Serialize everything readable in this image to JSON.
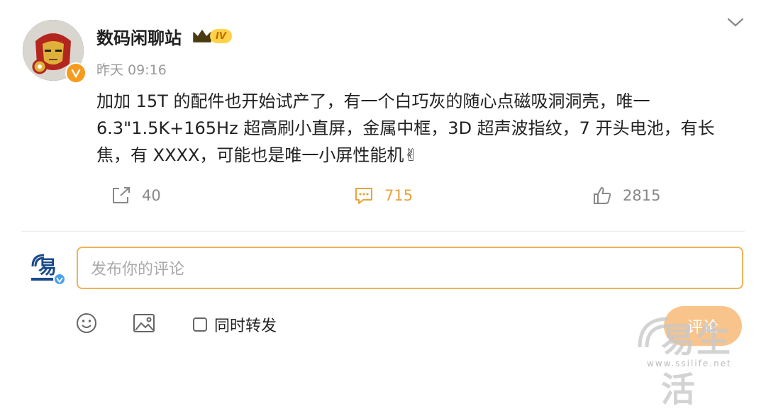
{
  "author": {
    "name": "数码闲聊站",
    "level_badge": "IV",
    "time": "昨天 09:16"
  },
  "post": {
    "lines": [
      "加加 15T 的配件也开始试产了，有一个白巧灰的随心点磁吸洞洞壳，唯一",
      "6.3\"1.5K+165Hz 超高刷小直屏，金属中框，3D 超声波指纹，7 开头电池，有长",
      "焦，有 XXXX，可能也是唯一小屏性能机✌"
    ]
  },
  "actions": {
    "repost_count": "40",
    "comment_count": "715",
    "like_count": "2815"
  },
  "comment_box": {
    "placeholder": "发布你的评论",
    "repost_option": "同时转发",
    "submit_label": "评论"
  },
  "watermark": {
    "text": "易生活",
    "url": "www.ssilife.net"
  },
  "colors": {
    "accent_orange": "#e8a33a",
    "input_border": "#f0b357",
    "submit_bg": "#f8c48b"
  },
  "icons": {
    "repost": "repost-icon",
    "comment": "comment-icon",
    "like": "thumb-up-icon",
    "emoji": "emoji-icon",
    "image": "image-icon",
    "menu": "chevron-down-icon"
  }
}
